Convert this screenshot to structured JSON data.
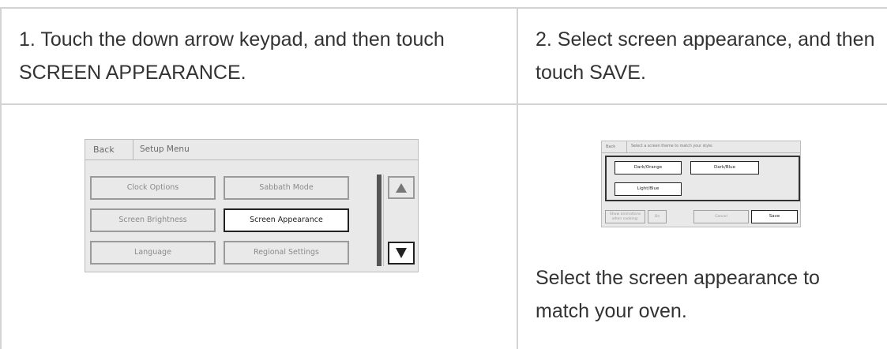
{
  "steps": {
    "step1": "1. Touch the down arrow keypad, and then touch SCREEN APPEARANCE.",
    "step2": "2. Select screen appearance, and then touch SAVE.",
    "caption": "Select the screen appearance to match your oven."
  },
  "setup_menu": {
    "back_label": "Back",
    "title": "Setup Menu",
    "options": [
      "Clock Options",
      "Sabbath Mode",
      "Screen Brightness",
      "Screen Appearance",
      "Language",
      "Regional Settings"
    ],
    "selected": "Screen Appearance",
    "up_arrow_icon": "up-triangle-icon",
    "down_arrow_icon": "down-triangle-icon"
  },
  "appearance_screen": {
    "back_label": "Back",
    "prompt": "Select a screen theme to match your style:",
    "themes": [
      "Dark/Orange",
      "Dark/Blue",
      "Light/Blue"
    ],
    "animations_label": "Show animations when cooking:",
    "animations_value": "On",
    "cancel_label": "Cancel",
    "save_label": "Save"
  }
}
